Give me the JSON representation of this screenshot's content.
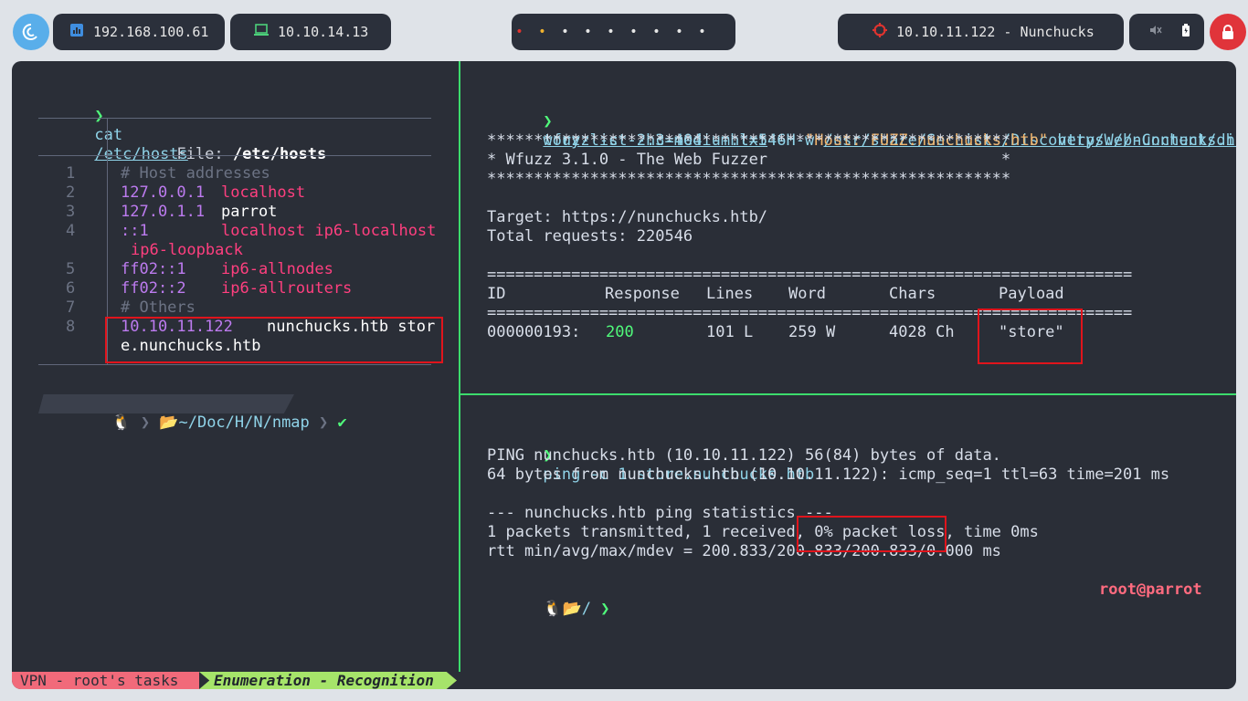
{
  "topbar": {
    "host_ip": "192.168.100.61",
    "vpn_ip": "10.10.14.13",
    "target": "10.10.11.122 - Nunchucks",
    "workspace_dots": [
      "•",
      "•",
      "•",
      "•",
      "•",
      "•",
      "•",
      "•",
      "•",
      "•"
    ]
  },
  "left_pane": {
    "prompt1": "❯",
    "cmd": "cat",
    "arg": "/etc/hosts",
    "file_label": "File: ",
    "file_name": "/etc/hosts",
    "lines": [
      {
        "num": "1",
        "addr": "# Host addresses",
        "host": ""
      },
      {
        "num": "2",
        "addr": "127.0.0.1",
        "host": "localhost"
      },
      {
        "num": "3",
        "addr": "127.0.1.1",
        "host": "parrot"
      },
      {
        "num": "4",
        "addr": "::1",
        "host": "localhost ip6-localhost"
      },
      {
        "num": "",
        "addr": "",
        "host": "ip6-loopback"
      },
      {
        "num": "5",
        "addr": "ff02::1",
        "host": "ip6-allnodes"
      },
      {
        "num": "6",
        "addr": "ff02::2",
        "host": "ip6-allrouters"
      },
      {
        "num": "7",
        "addr": "# Others",
        "host": ""
      },
      {
        "num": "8",
        "addr": "10.10.11.122",
        "host": "nunchucks.htb stor"
      },
      {
        "num": "",
        "addr": "",
        "host": "e.nunchucks.htb"
      }
    ],
    "path_prompt": "~/Doc/H/N/nmap",
    "check": "✔"
  },
  "right_top": {
    "prompt": "❯",
    "cmd_part1": "wfuzz -c --hc=404 --hl=546 -w ",
    "wordlist1": "/usr/share/SecLists/Discovery/Web-Content/direc",
    "wordlist2": "tory-list-2.3-medium.txt",
    "cmd_part2": " -H ",
    "header": "\"Host: FUZZ.nunchucks.htb\"",
    "url": " https://nunchucks.htb",
    "stars": "********************************************************",
    "banner": "* Wfuzz 3.1.0 - The Web Fuzzer                         *",
    "target": "Target: https://nunchucks.htb/",
    "total": "Total requests: 220546",
    "equals": "=====================================================================",
    "headers": [
      "ID",
      "Response",
      "Lines",
      "Word",
      "Chars",
      "Payload"
    ],
    "row": {
      "id": "000000193:",
      "response": "200",
      "lines": "101 L",
      "word": "259 W",
      "chars": "4028 Ch",
      "payload": "\"store\""
    }
  },
  "right_bottom": {
    "prompt": "❯",
    "cmd": "ping",
    "args": " -c 1 store.nunchucks.htb",
    "out1": "PING nunchucks.htb (10.10.11.122) 56(84) bytes of data.",
    "out2": "64 bytes from nunchucks.htb (10.10.11.122): icmp_seq=1 ttl=63 time=201 ms",
    "out3": "--- nunchucks.htb ping statistics ---",
    "out4": "1 packets transmitted, 1 received, 0% packet loss, time 0ms",
    "out5": "rtt min/avg/max/mdev = 200.833/200.833/200.833/0.000 ms",
    "prompt_path": "/",
    "user": "root@parrot"
  },
  "statusbar": {
    "left": "VPN - root's tasks",
    "mid": "Enumeration - Recognition"
  },
  "colors": {
    "accent_green": "#3cdc6c",
    "highlight_red": "#e0141c"
  }
}
